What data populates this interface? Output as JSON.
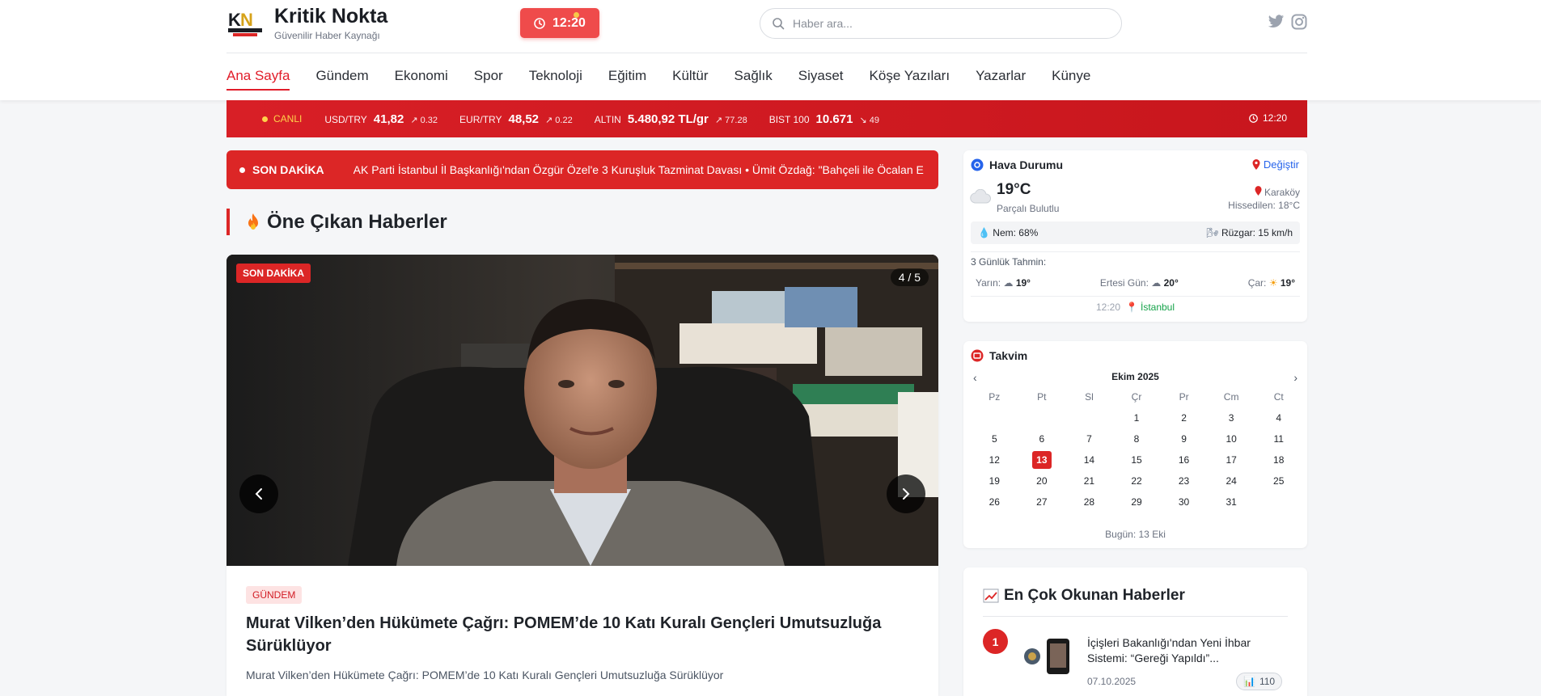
{
  "brand": {
    "name": "Kritik Nokta",
    "tagline": "Güvenilir Haber Kaynağı",
    "logo_text": "KRİTİK NOKTA"
  },
  "header": {
    "clock": "12:20",
    "search_placeholder": "Haber ara...",
    "social": [
      "twitter-icon",
      "instagram-icon"
    ]
  },
  "nav": [
    {
      "label": "Ana Sayfa",
      "active": true
    },
    {
      "label": "Gündem"
    },
    {
      "label": "Ekonomi"
    },
    {
      "label": "Spor"
    },
    {
      "label": "Teknoloji"
    },
    {
      "label": "Eğitim"
    },
    {
      "label": "Kültür"
    },
    {
      "label": "Sağlık"
    },
    {
      "label": "Siyaset"
    },
    {
      "label": "Köşe Yazıları"
    },
    {
      "label": "Yazarlar"
    },
    {
      "label": "Künye"
    }
  ],
  "market": {
    "live_label": "CANLI",
    "items": [
      {
        "label": "USD/TRY",
        "value": "41,82",
        "change": "↗ 0.32"
      },
      {
        "label": "EUR/TRY",
        "value": "48,52",
        "change": "↗ 0.22"
      },
      {
        "label": "ALTIN",
        "value": "5.480,92 TL/gr",
        "change": "↗ 77.28"
      },
      {
        "label": "BIST 100",
        "value": "10.671",
        "change": "↘ 49"
      }
    ],
    "time": "12:20"
  },
  "breaking": {
    "label": "SON DAKİKA",
    "text": "AK Parti İstanbul İl Başkanlığı'ndan Özgür Özel'e 3 Kuruşluk Tazminat Davası • Ümit Özdağ: \"Bahçeli ile Öcalan E"
  },
  "featured_section": {
    "title": "Öne Çıkan Haberler"
  },
  "featured": {
    "badge": "SON DAKİKA",
    "counter": "4 / 5",
    "category": "GÜNDEM",
    "title": "Murat Vilken’den Hükümete Çağrı: POMEM’de 10 Katı Kuralı Gençleri Umutsuzluğa Sürüklüyor",
    "description": "Murat Vilken’den Hükümete Çağrı: POMEM’de 10 Katı Kuralı Gençleri Umutsuzluğa Sürüklüyor"
  },
  "weather": {
    "title": "Hava Durumu",
    "change_label": "Değiştir",
    "temp": "19°C",
    "condition": "Parçalı Bulutlu",
    "district": "Karaköy",
    "feels_like": "Hissedilen: 18°C",
    "humidity": "Nem: 68%",
    "wind": "Rüzgar: 15 km/h",
    "forecast_label": "3 Günlük Tahmin:",
    "forecast": [
      {
        "day": "Yarın:",
        "temp": "19°"
      },
      {
        "day": "Ertesi Gün:",
        "temp": "20°"
      },
      {
        "day": "Çar:",
        "temp": "19°"
      }
    ],
    "updated": "12:20",
    "city": "İstanbul"
  },
  "calendar": {
    "title": "Takvim",
    "month": "Ekim 2025",
    "weekdays": [
      "Pz",
      "Pt",
      "Sl",
      "Çr",
      "Pr",
      "Cm",
      "Ct"
    ],
    "leading_blanks": 3,
    "days": 31,
    "today": 13,
    "footer": "Bugün: 13 Eki"
  },
  "popular": {
    "title": "En Çok Okunan Haberler",
    "items": [
      {
        "rank": "1",
        "title": "İçişleri Bakanlığı'ndan Yeni İhbar Sistemi: “Gereği Yapıldı”...",
        "date": "07.10.2025",
        "views": "110"
      }
    ]
  },
  "colors": {
    "brand_red": "#dc2626",
    "link_blue": "#2563eb",
    "accent_yellow": "#ffd24a",
    "city_green": "#16a34a"
  }
}
